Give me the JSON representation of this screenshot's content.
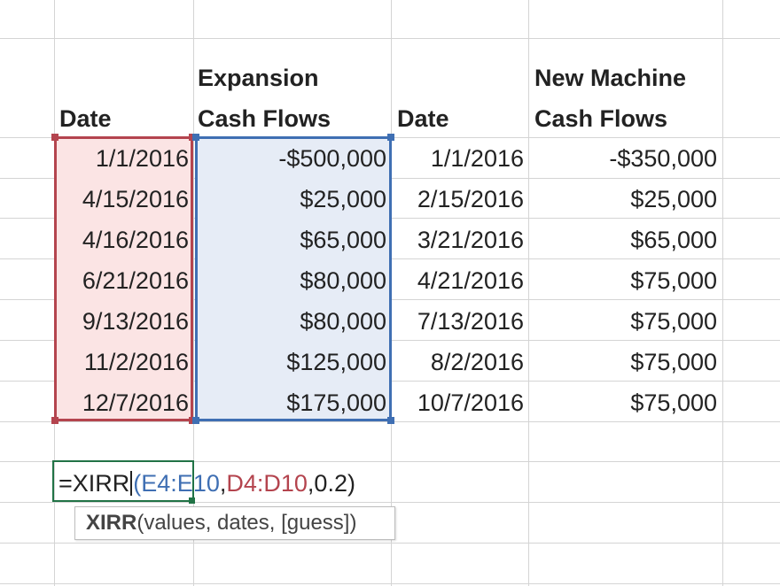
{
  "sheet": {
    "headers": {
      "date_left": "Date",
      "expansion_line1": "Expansion",
      "expansion_line2": "Cash Flows",
      "date_right": "Date",
      "machine_line1": "New Machine",
      "machine_line2": "Cash Flows"
    },
    "rows": [
      {
        "date1": "1/1/2016",
        "expansion": "-$500,000",
        "date2": "1/1/2016",
        "machine": "-$350,000"
      },
      {
        "date1": "4/15/2016",
        "expansion": "$25,000",
        "date2": "2/15/2016",
        "machine": "$25,000"
      },
      {
        "date1": "4/16/2016",
        "expansion": "$65,000",
        "date2": "3/21/2016",
        "machine": "$65,000"
      },
      {
        "date1": "6/21/2016",
        "expansion": "$80,000",
        "date2": "4/21/2016",
        "machine": "$75,000"
      },
      {
        "date1": "9/13/2016",
        "expansion": "$80,000",
        "date2": "7/13/2016",
        "machine": "$75,000"
      },
      {
        "date1": "11/2/2016",
        "expansion": "$125,000",
        "date2": "8/2/2016",
        "machine": "$75,000"
      },
      {
        "date1": "12/7/2016",
        "expansion": "$175,000",
        "date2": "10/7/2016",
        "machine": "$75,000"
      }
    ],
    "formula": {
      "prefix": "=XIRR",
      "open_paren": "(",
      "values_ref": "E4:E10",
      "sep1": ",",
      "dates_ref": "D4:D10",
      "rest": ",0.2)"
    },
    "tooltip": {
      "function_name": "XIRR",
      "args": "(values, dates, [guess])"
    }
  },
  "colors": {
    "values_ref": "#3f6fb3",
    "dates_ref": "#b4444e",
    "active_cell_border": "#217346",
    "gridline": "#d4d4d4"
  }
}
